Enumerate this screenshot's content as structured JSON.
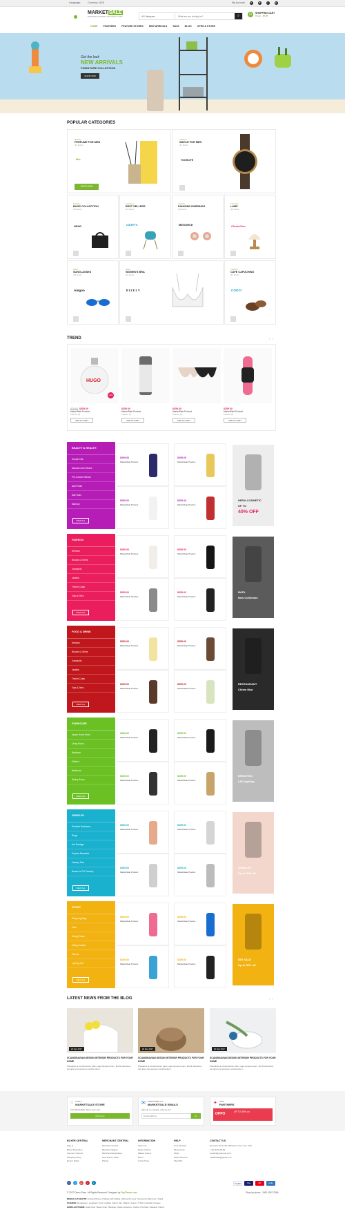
{
  "topbar": {
    "language": "Language:",
    "currency": "Currency: USD",
    "my_account": "My Account",
    "icons": [
      "heart-icon",
      "compare-icon",
      "user-icon",
      "cart-icon"
    ]
  },
  "header": {
    "logo_main": "MARKET",
    "logo_accent": "SALE",
    "logo_sub": "BRANDED SHOPPING WITH MANY CARS",
    "search_category": "All Categories",
    "search_placeholder": "What are you looking for?",
    "cart_title": "SHOPPING CART",
    "cart_items": "0 item",
    "cart_total": "$0.00",
    "nav": [
      "HOME",
      "FEATURES",
      "FEATURE STORES",
      "NEW ARRIVALS",
      "SALE",
      "BLOG",
      "OPEN A STORE"
    ]
  },
  "banner": {
    "line1": "Get the look",
    "line2": "NEW ARRIVALS",
    "line3": "FURNITURE COLLECTION",
    "button": "SHOP NOW"
  },
  "popular_categories": {
    "title": "POPULAR CATEGORIES",
    "shop_now": "SHOP NOW",
    "cells": [
      {
        "sub": "Beauty",
        "name": "PERFUME FOR MEN",
        "count": "(12 items)",
        "brand": "Mix"
      },
      {
        "sub": "Fashion",
        "name": "WATCH FOR MEN",
        "count": "(12 items)",
        "brand": "TOOHLIFE"
      },
      {
        "sub": "Fashion",
        "name": "BAGS COLLECTION",
        "count": "(12 items)",
        "brand": "uovo"
      },
      {
        "sub": "Furniture",
        "name": "BEST SELLERS",
        "count": "(12 items)",
        "brand": "carter's"
      },
      {
        "sub": "Jewelry",
        "name": "DIAMOND EARRINGS",
        "count": "(12 items)",
        "brand": "MEGORCE"
      },
      {
        "sub": "Furniture",
        "name": "LAMP",
        "count": "(12 items)",
        "brand": "ChoiceFun"
      },
      {
        "sub": "Sport",
        "name": "SUNGLASSES",
        "count": "(12 items)",
        "brand": "Aingoo"
      },
      {
        "sub": "Sport",
        "name": "WOMEN'S BRA",
        "count": "(12 items)",
        "brand": "BIZELY"
      },
      {
        "sub": "Fashion",
        "name": "CAFE CAPUCHINO",
        "count": "(12 items)",
        "brand": "COO'O"
      }
    ]
  },
  "trend": {
    "title": "TREND",
    "items": [
      {
        "old": "$79.00",
        "price": "$355.00",
        "name": "MarketSale Product",
        "cat": "Fashion (2)",
        "button": "ADD TO CART",
        "sale": "-20%"
      },
      {
        "old": "",
        "price": "$359.00",
        "name": "MarketSale Product",
        "cat": "Fashion (2)",
        "button": "ADD TO CART",
        "sale": ""
      },
      {
        "old": "",
        "price": "$359.00",
        "name": "MarketSale Product",
        "cat": "Fashion (2)",
        "button": "ADD TO CART",
        "sale": ""
      },
      {
        "old": "",
        "price": "$359.00",
        "name": "MarketSale Product",
        "cat": "Fashion (2)",
        "button": "ADD TO CART",
        "sale": ""
      }
    ]
  },
  "blocks": [
    {
      "title": "BEAUTY & HEALTH",
      "color": "#b61db6",
      "price_color": "#b61db6",
      "items": [
        "Human Hair",
        "Natural Color Weave",
        "Pre-Colored Weave",
        "Nail Polish",
        "Nail Tools",
        "Makeup"
      ],
      "view": "VIEW ALL",
      "promo": [
        "HERA-COSMETIC",
        "UP TO",
        "40% OFF"
      ],
      "promo_bg": "#ededed",
      "price": "$359.00",
      "pname": "MarketSale Product"
    },
    {
      "title": "FASHION",
      "color": "#ea1d5d",
      "price_color": "#ea1d5d",
      "items": [
        "Dresses",
        "Blouses & Shirts",
        "Jumpsuits",
        "Jackets",
        "Trench Coats",
        "Tops & Tees"
      ],
      "view": "VIEW ALL",
      "promo": [
        "BATA",
        "New Collection"
      ],
      "promo_bg": "#5b5b5b",
      "price": "$359.00",
      "pname": "MarketSale Product"
    },
    {
      "title": "FOOD & DRINK",
      "color": "#c0171c",
      "price_color": "#c0171c",
      "items": [
        "Dresses",
        "Blouses & Shirts",
        "Jumpsuits",
        "Jackets",
        "Trench Coats",
        "Tops & Tees"
      ],
      "view": "VIEW ALL",
      "promo": [
        "RESTAURANT",
        "Chiem Mua"
      ],
      "promo_bg": "#2a2a2a",
      "price": "$359.00",
      "pname": "MarketSale Product"
    },
    {
      "title": "FURNITURE",
      "color": "#6bc123",
      "price_color": "#6bc123",
      "items": [
        "Space Home Store",
        "Living Room",
        "Bedroom",
        "Kitchen",
        "Bathroom",
        "Dining Room"
      ],
      "view": "VIEW ALL",
      "promo": [
        "BRIGHTEN",
        "LED lighting"
      ],
      "promo_bg": "#bdbdbd",
      "price": "$359.00",
      "pname": "MarketSale Product"
    },
    {
      "title": "JEWELRY",
      "color": "#1ab1cf",
      "price_color": "#1ab1cf",
      "items": [
        "Pendant Necklaces",
        "Rings",
        "Hot Earrings",
        "Popular Bracelets",
        "Jewelry Sets",
        "Beads for DIY Jewelry"
      ],
      "view": "VIEW ALL",
      "promo": [
        "JEWELRY",
        "Up to 50% off"
      ],
      "promo_bg": "#f3d7cd",
      "price": "$359.00",
      "pname": "MarketSale Product"
    },
    {
      "title": "SPORT",
      "color": "#f2b212",
      "price_color": "#f2b212",
      "items": [
        "Shopping Bags",
        "Hats",
        "Hiking Shoes",
        "Hiking Jackets",
        "Fitness",
        "Cycling Suit"
      ],
      "view": "VIEW ALL",
      "promo": [
        "BIG SALE",
        "Up to 50% off"
      ],
      "promo_bg": "#f2b212",
      "price": "$359.00",
      "pname": "MarketSale Product"
    }
  ],
  "news": {
    "title": "LATEST NEWS FROM THE BLOG",
    "items": [
      {
        "date": "20 Dec 2017",
        "title": "SCANDINAVIAN DESIGN INTERIOR PRODUCTS FOR YOUR HOME",
        "text": "Phasellus ut condimentum diam, eget tempus lorem. Morbi bibendum est quis eros posuere condimentum."
      },
      {
        "date": "20 Dec 2017",
        "title": "SCANDINAVIAN DESIGN INTERIOR PRODUCTS FOR YOUR HOME",
        "text": "Phasellus ut condimentum diam, eget tempus lorem. Morbi bibendum est quis eros posuere condimentum."
      },
      {
        "date": "20 Dec 2017",
        "title": "SCANDINAVIAN DESIGN INTERIOR PRODUCTS FOR YOUR HOME",
        "text": "Phasellus ut condimentum diam, eget tempus lorem. Morbi bibendum est quis eros posuere condimentum."
      }
    ]
  },
  "bottom_boxes": [
    {
      "top": "FIND A",
      "bold": "MARKETSALE STORE",
      "line": "Find MarketSale Store near you!",
      "button": "Click here"
    },
    {
      "top": "SUBSCRIBE TO",
      "bold": "MARKETSALE EMAILS",
      "line": "Sign up to a simple, dummy text",
      "placeholder": "Email address",
      "button": "Go"
    },
    {
      "top": "OUR",
      "bold": "PARTNERS",
      "promo": "UP TO 50% on"
    }
  ],
  "footer": {
    "columns": [
      {
        "head": "BUYER CENTRAL",
        "items": [
          "Sign in",
          "Brand Promotion",
          "Payment Options",
          "Shipping Policy",
          "Return Policy"
        ]
      },
      {
        "head": "MERCHANT CENTRAL",
        "items": [
          "Merchant Central",
          "Merchant Signup",
          "Merchant Registration",
          "How Does it Work",
          "Pricing"
        ]
      },
      {
        "head": "INFORMATION",
        "items": [
          "About Us",
          "Rules of Trust",
          "Market History",
          "Event",
          "In the Press"
        ]
      },
      {
        "head": "HELP",
        "items": [
          "How will Help",
          "My Account",
          "FAQs",
          "Other Services",
          "Shop Bot"
        ]
      },
      {
        "head": "CONTACT US",
        "items": [
          "Example Street 68, Mahattan, New York, USA",
          "+ 00 (123) 45-90",
          "contact@example.com",
          "marketsale@gmail.com"
        ]
      }
    ],
    "social": [
      "f",
      "t",
      "g+",
      "p",
      "in"
    ],
    "payments": [
      "PayPal",
      "Visa",
      "MC",
      "AmEx"
    ],
    "copyright": "© 2017 Demo Store. All Rights Reserved. Designed by",
    "designer": "TopTheme.com",
    "shop_by": "Shop by phone : 1900-1507-2366",
    "tags": [
      {
        "head": "MOBILE & TABLETS:",
        "text": "Android Phones | Tablets with Calling | Microsoft Lumia | Samsung | Micromax | Nokia"
      },
      {
        "head": "FASHION:",
        "text": "Sunglasses | Leggings | Tunic | Adidas | Maxi | Sari | Watch | Jeans | T-Shirt | Sandals | Sarees"
      },
      {
        "head": "HOME & KITCHEN:",
        "text": "Desk Chair | Bean Chair | Bangles | Glass Ceramics | Cabins | Pet Mat | Glasspot | Decor"
      }
    ]
  }
}
